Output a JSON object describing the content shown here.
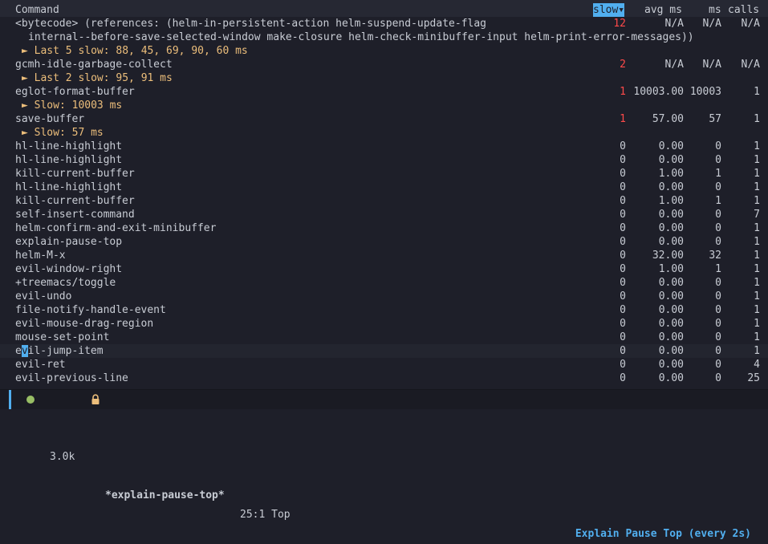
{
  "header": {
    "command": "Command",
    "slow": "slow▾",
    "avg": "avg ms",
    "ms": "ms",
    "calls": "calls"
  },
  "rows": [
    {
      "command": "<bytecode> (references: (helm-in-persistent-action helm-suspend-update-flag",
      "slow": "12",
      "avg": "N/A",
      "ms": "N/A",
      "calls": "N/A",
      "red": true
    },
    {
      "cont": "internal--before-save-selected-window make-closure helm-check-minibuffer-input helm-print-error-messages))"
    },
    {
      "detail": "► Last 5 slow: 88, 45, 69, 90, 60 ms"
    },
    {
      "command": "gcmh-idle-garbage-collect",
      "slow": "2",
      "avg": "N/A",
      "ms": "N/A",
      "calls": "N/A",
      "red": true
    },
    {
      "detail": "► Last 2 slow: 95, 91 ms"
    },
    {
      "command": "eglot-format-buffer",
      "slow": "1",
      "avg": "10003.00",
      "ms": "10003",
      "calls": "1",
      "red": true
    },
    {
      "detail": "► Slow: 10003 ms"
    },
    {
      "command": "save-buffer",
      "slow": "1",
      "avg": "57.00",
      "ms": "57",
      "calls": "1",
      "red": true
    },
    {
      "detail": "► Slow: 57 ms"
    },
    {
      "command": "hl-line-highlight",
      "slow": "0",
      "avg": "0.00",
      "ms": "0",
      "calls": "1"
    },
    {
      "command": "hl-line-highlight",
      "slow": "0",
      "avg": "0.00",
      "ms": "0",
      "calls": "1"
    },
    {
      "command": "kill-current-buffer",
      "slow": "0",
      "avg": "1.00",
      "ms": "1",
      "calls": "1"
    },
    {
      "command": "hl-line-highlight",
      "slow": "0",
      "avg": "0.00",
      "ms": "0",
      "calls": "1"
    },
    {
      "command": "kill-current-buffer",
      "slow": "0",
      "avg": "1.00",
      "ms": "1",
      "calls": "1"
    },
    {
      "command": "self-insert-command",
      "slow": "0",
      "avg": "0.00",
      "ms": "0",
      "calls": "7"
    },
    {
      "command": "helm-confirm-and-exit-minibuffer",
      "slow": "0",
      "avg": "0.00",
      "ms": "0",
      "calls": "1"
    },
    {
      "command": "explain-pause-top",
      "slow": "0",
      "avg": "0.00",
      "ms": "0",
      "calls": "1"
    },
    {
      "command": "helm-M-x",
      "slow": "0",
      "avg": "32.00",
      "ms": "32",
      "calls": "1"
    },
    {
      "command": "evil-window-right",
      "slow": "0",
      "avg": "1.00",
      "ms": "1",
      "calls": "1"
    },
    {
      "command": "+treemacs/toggle",
      "slow": "0",
      "avg": "0.00",
      "ms": "0",
      "calls": "1"
    },
    {
      "command": "evil-undo",
      "slow": "0",
      "avg": "0.00",
      "ms": "0",
      "calls": "1"
    },
    {
      "command": "file-notify-handle-event",
      "slow": "0",
      "avg": "0.00",
      "ms": "0",
      "calls": "1"
    },
    {
      "command": "evil-mouse-drag-region",
      "slow": "0",
      "avg": "0.00",
      "ms": "0",
      "calls": "1"
    },
    {
      "command": "mouse-set-point",
      "slow": "0",
      "avg": "0.00",
      "ms": "0",
      "calls": "1"
    },
    {
      "command_pre": "e",
      "command_cursor": "v",
      "command_post": "il-jump-item",
      "slow": "0",
      "avg": "0.00",
      "ms": "0",
      "calls": "1",
      "current": true
    },
    {
      "command": "evil-ret",
      "slow": "0",
      "avg": "0.00",
      "ms": "0",
      "calls": "4"
    },
    {
      "command": "evil-previous-line",
      "slow": "0",
      "avg": "0.00",
      "ms": "0",
      "calls": "25"
    }
  ],
  "modeline": {
    "size": "3.0k",
    "buffer": "*explain-pause-top*",
    "position": "25:1 Top",
    "mode": "Explain Pause Top (every 2s)",
    "status_color": "#98be65",
    "accent_color": "#51afef",
    "lock_icon": "lock-icon"
  },
  "colors": {
    "background": "#1e1f29",
    "slow_highlight": "#ff4a4a",
    "detail": "#ecbe7b",
    "sort_highlight": "#51afef"
  }
}
